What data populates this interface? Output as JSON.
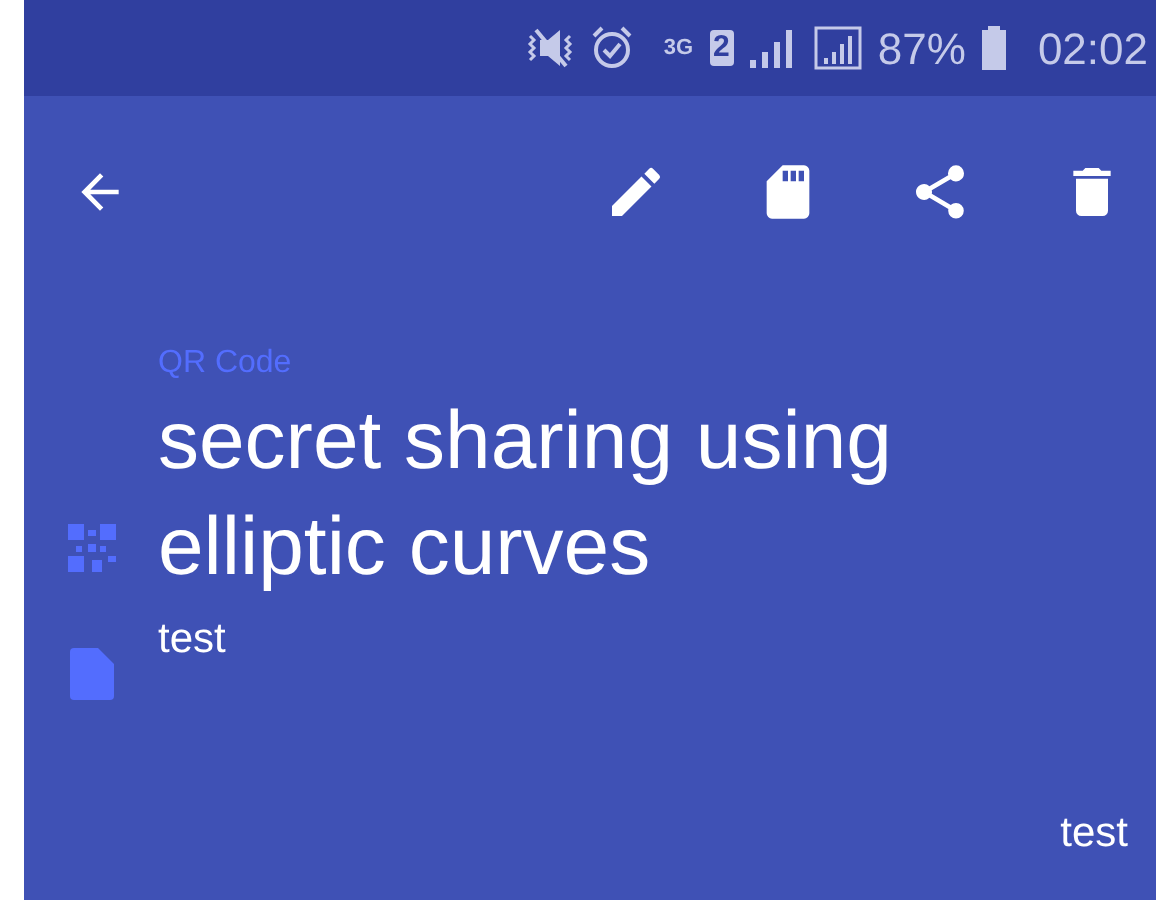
{
  "status_bar": {
    "network": "3G",
    "sim": "2",
    "battery": "87%",
    "time": "02:02"
  },
  "toolbar": {
    "actions": [
      {
        "kind": "edit"
      },
      {
        "kind": "sd"
      },
      {
        "kind": "share"
      },
      {
        "kind": "delete"
      }
    ]
  },
  "item": {
    "type_label": "QR Code",
    "title": "secret sharing using elliptic curves",
    "note": "test"
  },
  "footer": "test"
}
